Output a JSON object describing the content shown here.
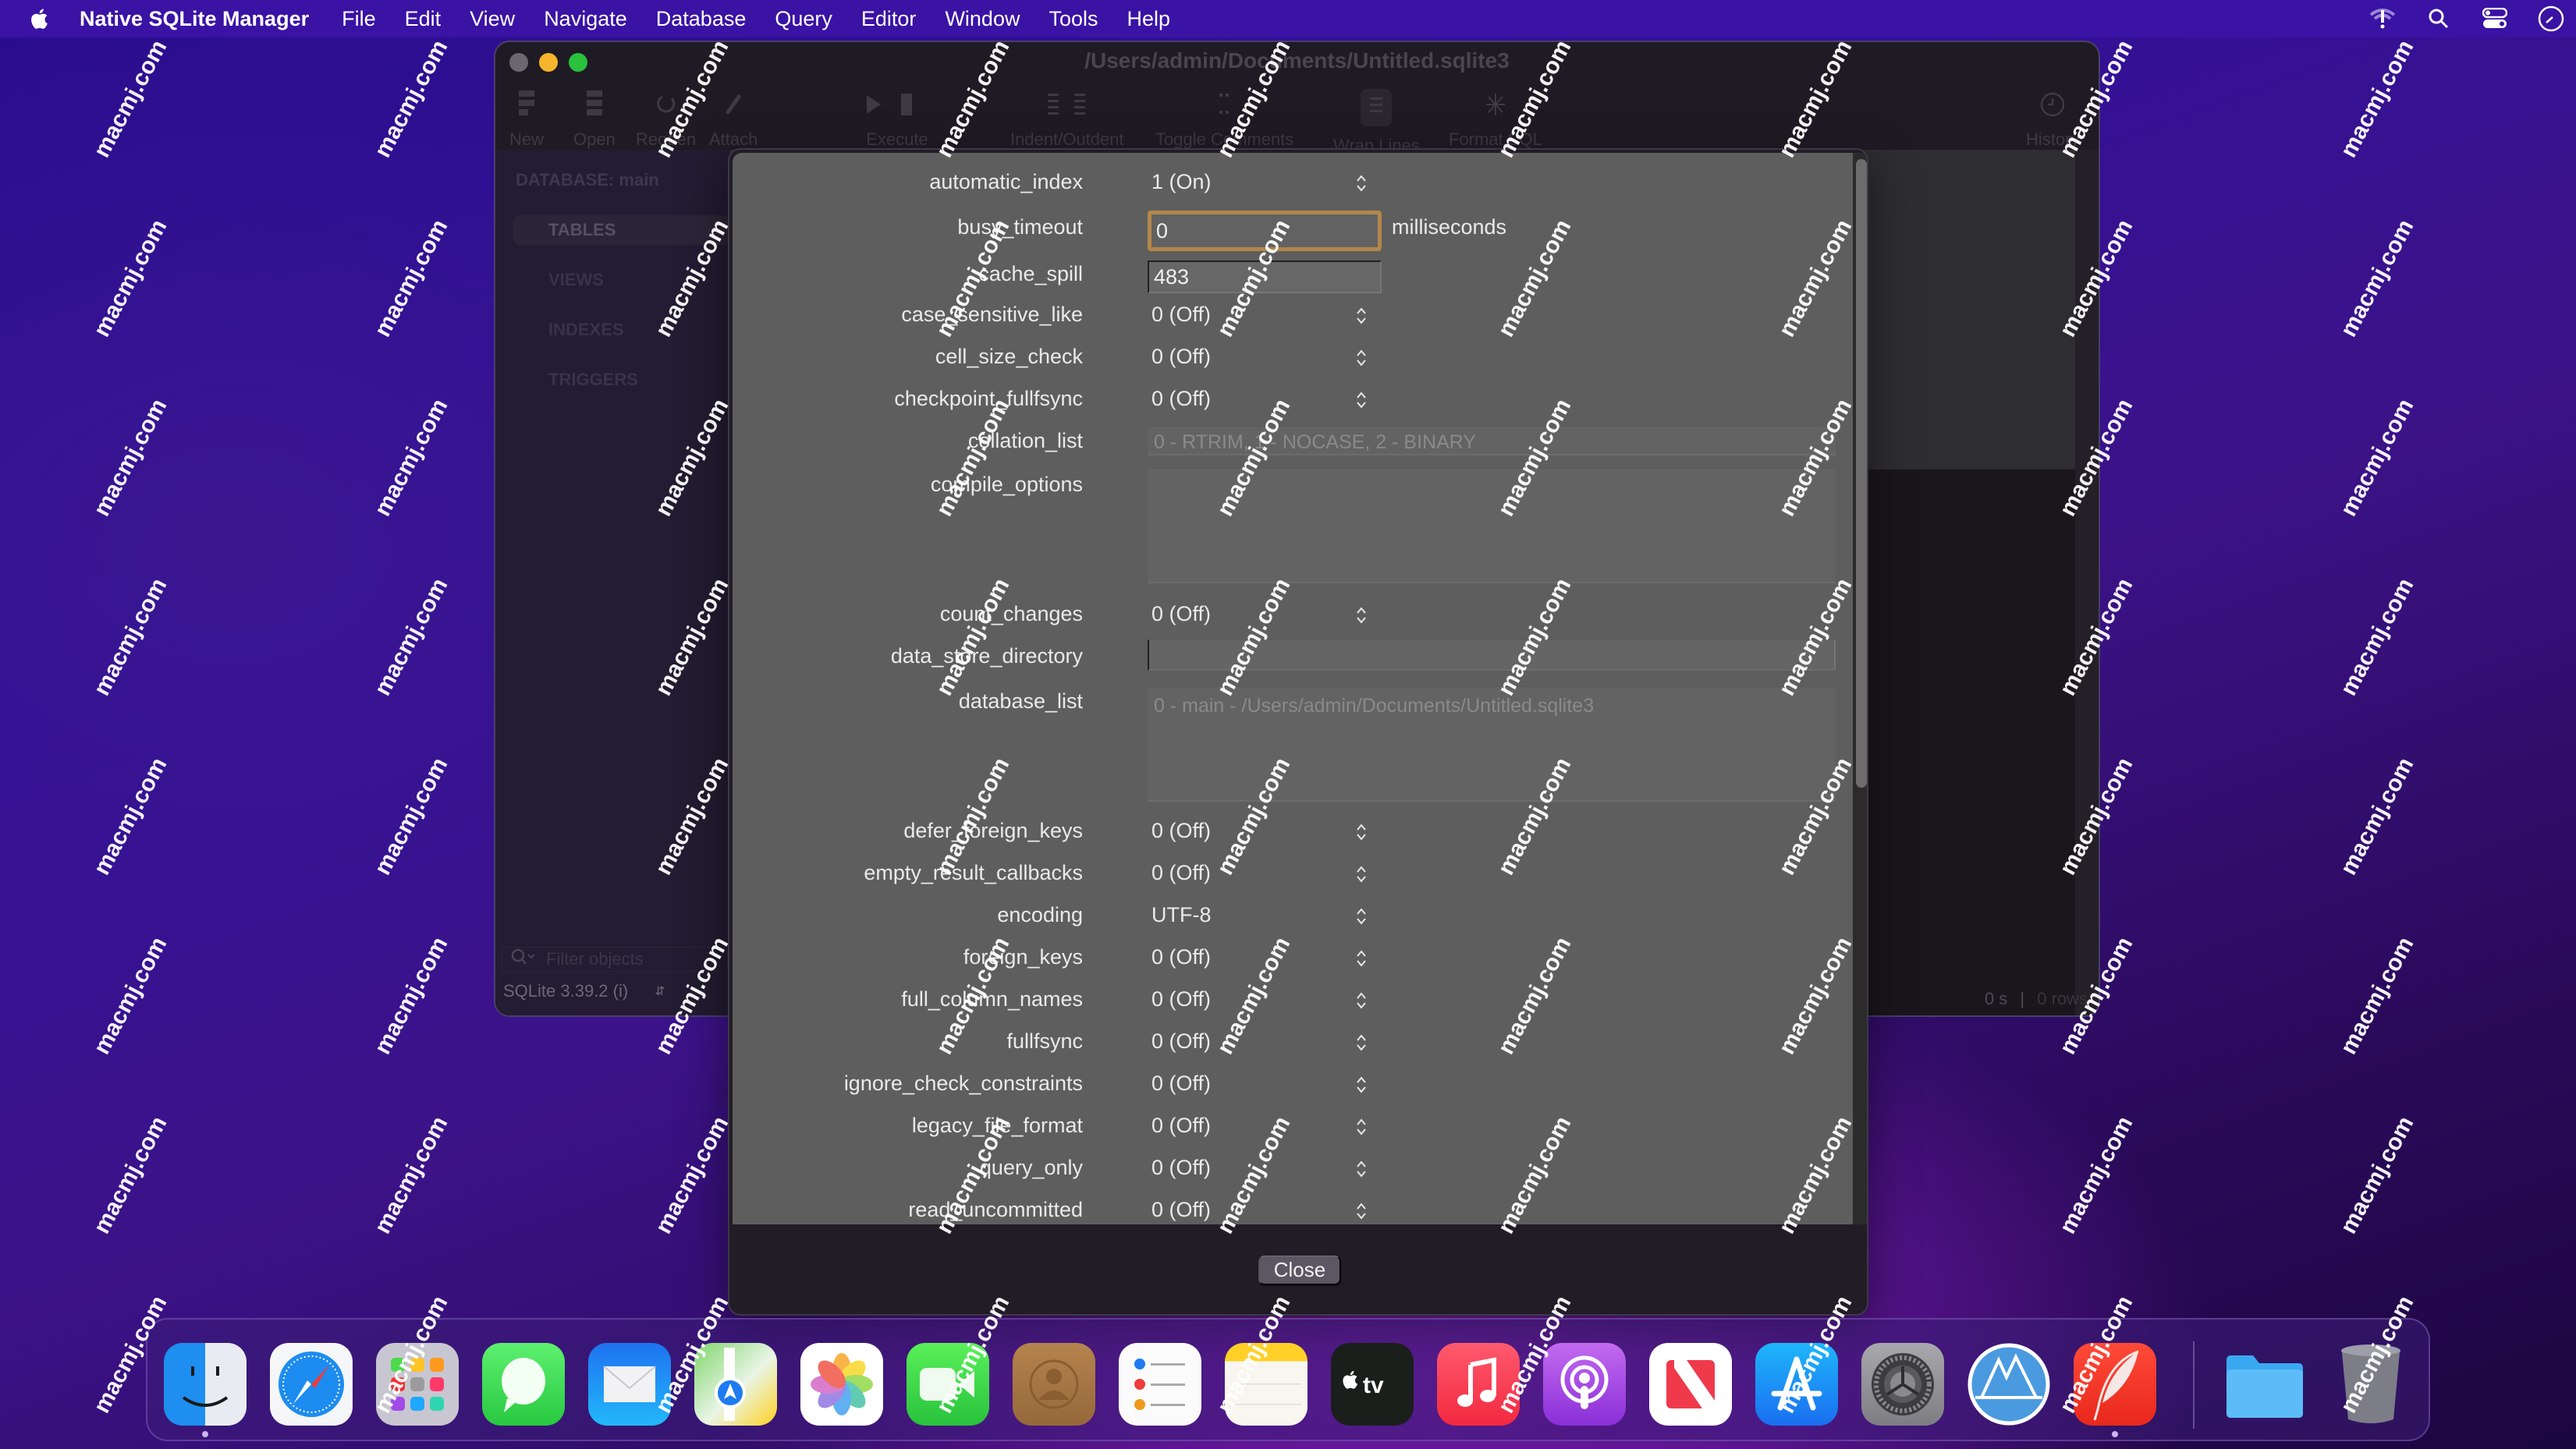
{
  "menubar": {
    "app_name": "Native SQLite Manager",
    "items": [
      "File",
      "Edit",
      "View",
      "Navigate",
      "Database",
      "Query",
      "Editor",
      "Window",
      "Tools",
      "Help"
    ],
    "status_icons": [
      "wifi-warning-icon",
      "spotlight-search-icon",
      "control-center-icon",
      "clock-icon"
    ]
  },
  "window": {
    "title": "/Users/admin/Documents/Untitled.sqlite3",
    "toolbar": [
      {
        "label": "New",
        "icon": "new-icon"
      },
      {
        "label": "Open",
        "icon": "open-icon"
      },
      {
        "label": "Reopen",
        "icon": "reopen-icon"
      },
      {
        "label": "Attach",
        "icon": "attach-icon"
      },
      {
        "label": "Execute",
        "icon": "execute-icon"
      },
      {
        "label": "Indent/Outdent",
        "icon": "indent-icon"
      },
      {
        "label": "Toggle Comments",
        "icon": "comment-icon"
      },
      {
        "label": "Wrap Lines",
        "icon": "wrap-icon"
      },
      {
        "label": "Format SQL",
        "icon": "format-icon"
      },
      {
        "label": "History",
        "icon": "history-icon"
      }
    ],
    "sidebar": {
      "database_label": "DATABASE: main",
      "nav": [
        "TABLES",
        "VIEWS",
        "INDEXES",
        "TRIGGERS"
      ],
      "active_nav": "TABLES",
      "filter_placeholder": "Filter objects",
      "version": "SQLite 3.39.2 (i)"
    },
    "status": {
      "time": "0 s",
      "separator": "|",
      "rows": "0 rows"
    }
  },
  "dialog": {
    "pragmas": [
      {
        "name": "automatic_index",
        "type": "select",
        "value": "1 (On)"
      },
      {
        "name": "busy_timeout",
        "type": "text",
        "value": "0",
        "unit": "milliseconds",
        "focused": true
      },
      {
        "name": "cache_spill",
        "type": "text",
        "value": "483"
      },
      {
        "name": "case_sensitive_like",
        "type": "select",
        "value": "0 (Off)"
      },
      {
        "name": "cell_size_check",
        "type": "select",
        "value": "0 (Off)"
      },
      {
        "name": "checkpoint_fullfsync",
        "type": "select",
        "value": "0 (Off)"
      },
      {
        "name": "collation_list",
        "type": "readonly",
        "value": "0 - RTRIM, 1 - NOCASE, 2 - BINARY"
      },
      {
        "name": "compile_options",
        "type": "readonly-multiline",
        "value": ""
      },
      {
        "name": "count_changes",
        "type": "select",
        "value": "0 (Off)"
      },
      {
        "name": "data_store_directory",
        "type": "text-wide",
        "value": ""
      },
      {
        "name": "database_list",
        "type": "readonly-multiline",
        "value": "0 - main - /Users/admin/Documents/Untitled.sqlite3"
      },
      {
        "name": "defer_foreign_keys",
        "type": "select",
        "value": "0 (Off)"
      },
      {
        "name": "empty_result_callbacks",
        "type": "select",
        "value": "0 (Off)"
      },
      {
        "name": "encoding",
        "type": "select",
        "value": "UTF-8"
      },
      {
        "name": "foreign_keys",
        "type": "select",
        "value": "0 (Off)"
      },
      {
        "name": "full_column_names",
        "type": "select",
        "value": "0 (Off)"
      },
      {
        "name": "fullfsync",
        "type": "select",
        "value": "0 (Off)"
      },
      {
        "name": "ignore_check_constraints",
        "type": "select",
        "value": "0 (Off)"
      },
      {
        "name": "legacy_file_format",
        "type": "select",
        "value": "0 (Off)"
      },
      {
        "name": "query_only",
        "type": "select",
        "value": "0 (Off)"
      },
      {
        "name": "read_uncommitted",
        "type": "select",
        "value": "0 (Off)"
      }
    ],
    "close_label": "Close",
    "focus_color": "#b3874a"
  },
  "dock": {
    "apps": [
      {
        "name": "Finder",
        "running": true
      },
      {
        "name": "Safari",
        "running": false
      },
      {
        "name": "Launchpad",
        "running": false
      },
      {
        "name": "Messages",
        "running": false
      },
      {
        "name": "Mail",
        "running": false
      },
      {
        "name": "Maps",
        "running": false
      },
      {
        "name": "Photos",
        "running": false
      },
      {
        "name": "FaceTime",
        "running": false
      },
      {
        "name": "Contacts",
        "running": false
      },
      {
        "name": "Reminders",
        "running": false
      },
      {
        "name": "Notes",
        "running": false
      },
      {
        "name": "Apple TV",
        "running": false
      },
      {
        "name": "Music",
        "running": false
      },
      {
        "name": "Podcasts",
        "running": false
      },
      {
        "name": "News",
        "running": false
      },
      {
        "name": "App Store",
        "running": false
      },
      {
        "name": "System Preferences",
        "running": false
      },
      {
        "name": "Altitude",
        "running": false
      },
      {
        "name": "Native SQLite Manager",
        "running": true
      }
    ],
    "extras": [
      "Downloads",
      "Trash"
    ]
  },
  "watermark": "macmj.com"
}
